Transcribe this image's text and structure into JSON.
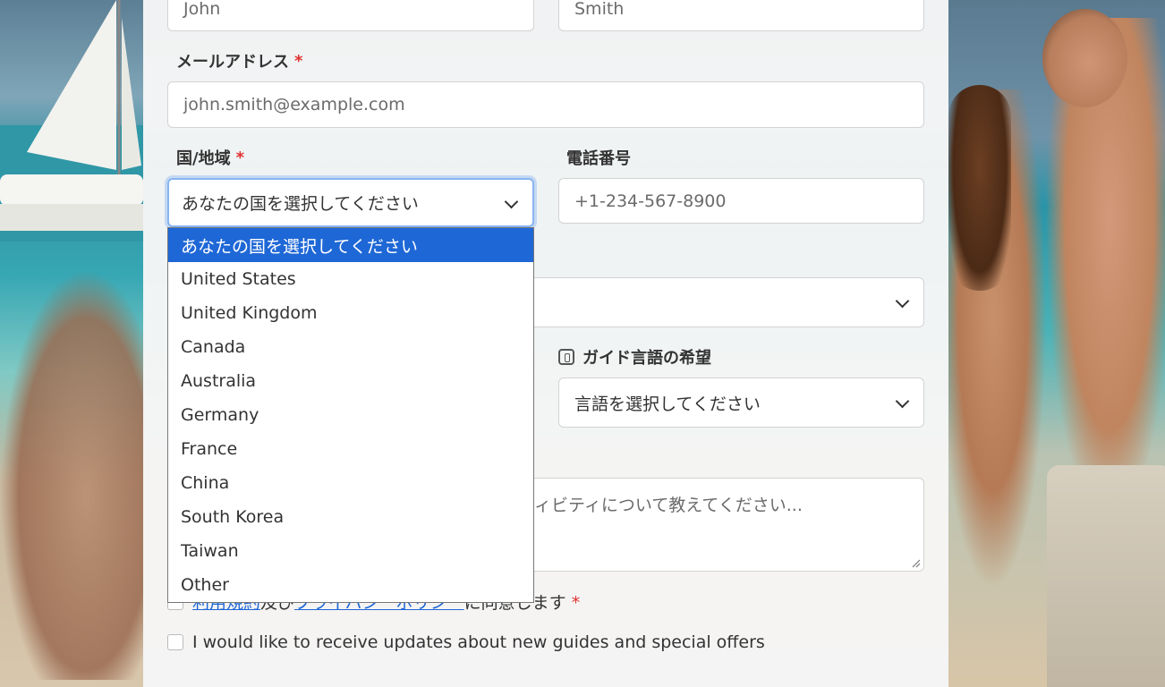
{
  "form": {
    "first_name_value": "John",
    "last_name_value": "Smith",
    "email": {
      "label": "メールアドレス",
      "required_mark": "*",
      "placeholder": "john.smith@example.com"
    },
    "country": {
      "label": "国/地域",
      "required_mark": "*",
      "selected": "あなたの国を選択してください",
      "options": [
        "あなたの国を選択してください",
        "United States",
        "United Kingdom",
        "Canada",
        "Australia",
        "Germany",
        "France",
        "China",
        "South Korea",
        "Taiwan",
        "Other"
      ]
    },
    "phone": {
      "label": "電話番号",
      "placeholder": "+1-234-567-8900"
    },
    "guide_language": {
      "label": "ガイド言語の希望",
      "icon": "language-icon",
      "selected": "言語を選択してください"
    },
    "message_placeholder_visible": "ィビティについて教えてください...",
    "terms": {
      "link1": "利用規約",
      "joiner": "及び",
      "link2": "プライバシーポリシー",
      "suffix": "に同意します",
      "required_mark": "*"
    },
    "newsletter_label": "I would like to receive updates about new guides and special offers"
  },
  "colors": {
    "accent": "#1e67d6",
    "required": "#e03131"
  }
}
